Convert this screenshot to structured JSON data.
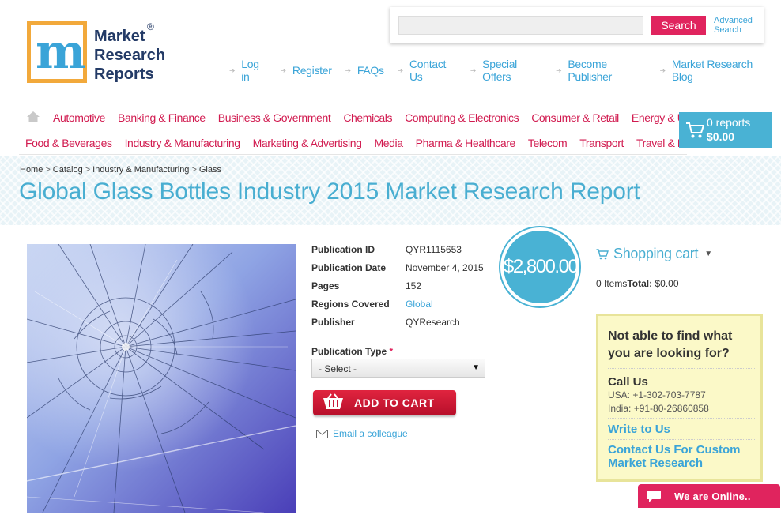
{
  "logo": {
    "line1": "Market",
    "line2": "Research",
    "line3": "Reports",
    "reg": "®",
    "mark": "m"
  },
  "search": {
    "placeholder": "",
    "button": "Search",
    "advanced_line1": "Advanced",
    "advanced_line2": "Search"
  },
  "topnav": [
    "Log in",
    "Register",
    "FAQs",
    "Contact Us",
    "Special Offers",
    "Become Publisher",
    "Market Research Blog"
  ],
  "categories_row1": [
    "Automotive",
    "Banking & Finance",
    "Business & Government",
    "Chemicals",
    "Computing & Electronics",
    "Consumer & Retail",
    "Energy & Utilities"
  ],
  "categories_row2": [
    "Food & Beverages",
    "Industry & Manufacturing",
    "Marketing & Advertising",
    "Media",
    "Pharma & Healthcare",
    "Telecom",
    "Transport",
    "Travel & Leisure"
  ],
  "cart": {
    "reports": "0 reports",
    "total": "$0.00"
  },
  "breadcrumb": [
    "Home",
    "Catalog",
    "Industry & Manufacturing",
    "Glass"
  ],
  "title": "Global Glass Bottles Industry 2015 Market Research Report",
  "details": [
    {
      "label": "Publication ID",
      "value": "QYR1115653"
    },
    {
      "label": "Publication Date",
      "value": "November 4, 2015"
    },
    {
      "label": "Pages",
      "value": "152"
    },
    {
      "label": "Regions Covered",
      "value": "Global"
    },
    {
      "label": "Publisher",
      "value": "QYResearch"
    }
  ],
  "publication_type": {
    "label": "Publication Type",
    "required": "*",
    "selected": "- Select -"
  },
  "add_to_cart": "ADD TO CART",
  "email_colleague": "Email a colleague",
  "price": "$2,800.00",
  "shopping_cart": {
    "title": "Shopping cart",
    "items": "0 Items",
    "total_label": "Total:",
    "total_value": "$0.00"
  },
  "help": {
    "question": "Not able to find what you are looking for?",
    "call_us": "Call Us",
    "phone_usa": "USA: +1-302-703-7787",
    "phone_india": "India: +91-80-26860858",
    "write": "Write to Us",
    "custom": "Contact Us For Custom Market Research"
  },
  "chat": "We are Online..",
  "colors": {
    "accent_blue": "#49b2d4",
    "accent_pink": "#e0245e",
    "category_red": "#d11a4f"
  }
}
